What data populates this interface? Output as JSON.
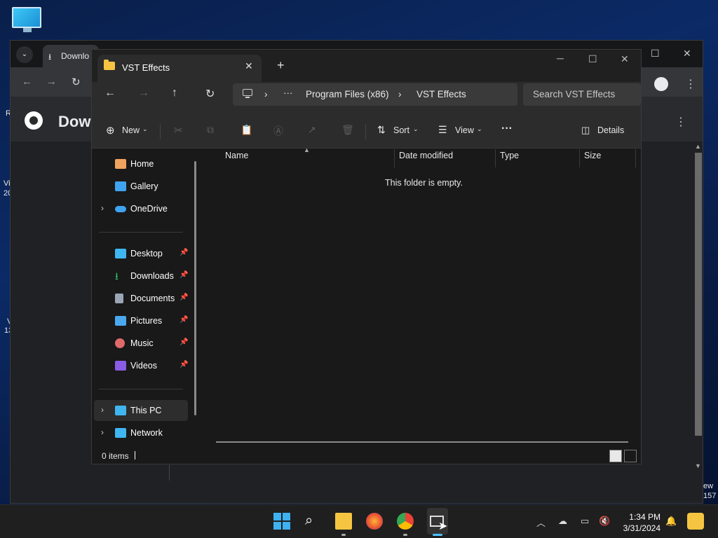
{
  "desktop": {
    "edge_fragments": [
      "R",
      "Vi",
      "20",
      "V",
      "13"
    ]
  },
  "chrome": {
    "tab_title": "Downlo",
    "page_title": "Dow",
    "right_fragment": [
      "ew",
      "157"
    ]
  },
  "explorer": {
    "tab_title": "VST Effects",
    "new_tab": "+",
    "close_tab": "✕",
    "window_controls": {
      "minimize": "─",
      "maximize": "☐",
      "close": "✕"
    },
    "address": {
      "more": "···",
      "segments": [
        "Program Files (x86)",
        "VST Effects"
      ],
      "sep": "›"
    },
    "search": {
      "placeholder": "Search VST Effects"
    },
    "commands": {
      "new": "New",
      "sort": "Sort",
      "view": "View",
      "more": "···",
      "details": "Details"
    },
    "nav": [
      {
        "label": "Home",
        "icon": "home-icon",
        "color": "#f0a35e"
      },
      {
        "label": "Gallery",
        "icon": "gallery-icon",
        "color": "#3fa3f0"
      },
      {
        "label": "OneDrive",
        "icon": "cloud-icon",
        "color": "#3fa3f0"
      },
      {
        "label": "Desktop",
        "icon": "desktop-icon",
        "color": "#3fb6f0"
      },
      {
        "label": "Downloads",
        "icon": "download-icon",
        "color": "#35c46b"
      },
      {
        "label": "Documents",
        "icon": "document-icon",
        "color": "#9aa6b5"
      },
      {
        "label": "Pictures",
        "icon": "picture-icon",
        "color": "#4aa8ef"
      },
      {
        "label": "Music",
        "icon": "music-icon",
        "color": "#e06a6a"
      },
      {
        "label": "Videos",
        "icon": "video-icon",
        "color": "#8b5ce6"
      },
      {
        "label": "This PC",
        "icon": "computer-icon",
        "color": "#3fb6f0"
      },
      {
        "label": "Network",
        "icon": "network-icon",
        "color": "#3fb6f0"
      }
    ],
    "columns": [
      "Name",
      "Date modified",
      "Type",
      "Size"
    ],
    "empty_message": "This folder is empty.",
    "status": {
      "count": "0 items"
    }
  },
  "taskbar": {
    "time": "1:34 PM",
    "date": "3/31/2024"
  },
  "colors": {
    "accent": "#0078d4"
  }
}
